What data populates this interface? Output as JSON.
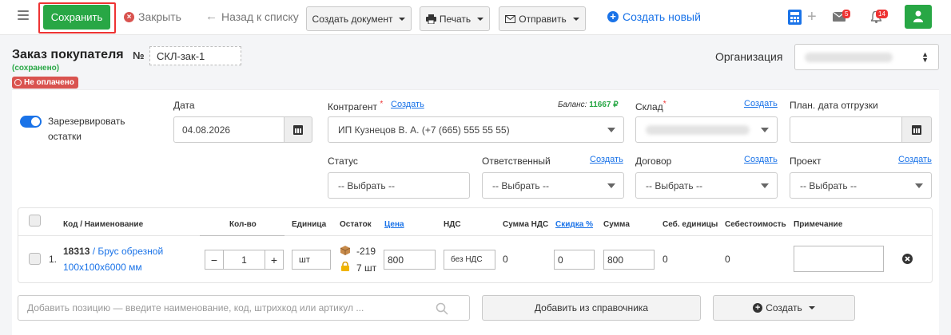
{
  "toolbar": {
    "save": "Сохранить",
    "close": "Закрыть",
    "back": "Назад к списку",
    "create_doc": "Создать документ",
    "print": "Печать",
    "send": "Отправить",
    "create_new": "Создать новый",
    "mail_count": "5",
    "notif_count": "14"
  },
  "header": {
    "title": "Заказ покупателя",
    "number_sign": "№",
    "number": "СКЛ-зак-1",
    "saved_status": "(сохранено)",
    "payment_status": "Не оплачено",
    "org_label": "Организация"
  },
  "form": {
    "reserve_label": "Зарезервировать остатки",
    "date_label": "Дата",
    "date_value": "04.08.2026",
    "counterparty_label": "Контрагент",
    "counterparty_create": "Создать",
    "balance_label": "Баланс:",
    "balance_value": "11667 ₽",
    "counterparty_value": "ИП Кузнецов В. А. (+7 (665) 555 55 55)",
    "warehouse_label": "Склад",
    "warehouse_create": "Создать",
    "ship_date_label": "План. дата отгрузки",
    "status_label": "Статус",
    "status_placeholder": "-- Выбрать --",
    "responsible_label": "Ответственный",
    "responsible_create": "Создать",
    "responsible_placeholder": "-- Выбрать --",
    "contract_label": "Договор",
    "contract_create": "Создать",
    "contract_placeholder": "-- Выбрать --",
    "project_label": "Проект",
    "project_create": "Создать",
    "project_placeholder": "-- Выбрать --"
  },
  "table": {
    "columns": [
      "Код / Наименование",
      "Кол-во",
      "Единица",
      "Остаток",
      "Цена",
      "НДС",
      "Сумма НДС",
      "Скидка %",
      "Сумма",
      "Себ. единицы",
      "Себестоимость",
      "Примечание"
    ],
    "rows": [
      {
        "index": "1.",
        "code": "18313",
        "sep": " / ",
        "name": "Брус обрезной 100х100х6000 мм",
        "qty": "1",
        "minus": "−",
        "plus": "+",
        "unit": "шт",
        "stock": "-219",
        "reserved": "7 шт",
        "price": "800",
        "vat": "без НДС",
        "vat_sum": "0",
        "discount": "0",
        "sum": "800",
        "unit_cost": "0",
        "cost": "0",
        "note": ""
      }
    ]
  },
  "bottom": {
    "add_placeholder": "Добавить позицию — введите наименование, код, штрихкод или артикул ...",
    "add_from_catalog": "Добавить из справочника",
    "create": "Создать"
  },
  "colors": {
    "accent": "#1a73e8",
    "success": "#28a745",
    "danger": "#d9534f"
  }
}
